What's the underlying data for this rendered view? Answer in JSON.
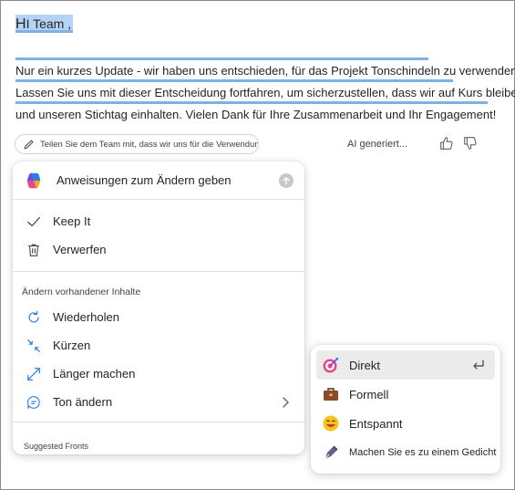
{
  "document": {
    "greeting_cap": "H",
    "greeting_rest": "I Team ,",
    "paragraph_lines": [
      "Nur ein kurzes Update - wir haben uns entschieden, für das Projekt Tonschindeln zu verwenden.",
      "Lassen Sie uns mit dieser Entscheidung fortfahren, um sicherzustellen, dass wir auf Kurs bleiben",
      "und unseren Stichtag einhalten. Vielen Dank für Ihre Zusammenarbeit und Ihr Engagement!"
    ]
  },
  "prompt_chip": {
    "text": "Teilen Sie dem Team mit, dass wir uns für die Verwendung entschieden haben..."
  },
  "ai_generated_label": "AI generiert...",
  "panel": {
    "instruction_placeholder": "Anweisungen zum Ändern geben",
    "actions": [
      {
        "label": "Keep It",
        "icon": "checkmark-icon"
      },
      {
        "label": "Verwerfen",
        "icon": "trash-icon"
      }
    ],
    "section_title": "Ändern vorhandener Inhalte",
    "modify_items": [
      {
        "label": "Wiederholen",
        "icon": "retry-icon"
      },
      {
        "label": "Kürzen",
        "icon": "shrink-icon"
      },
      {
        "label": "Länger machen",
        "icon": "expand-icon"
      },
      {
        "label": "Ton ändern",
        "icon": "chat-icon"
      }
    ],
    "bottom_peek": "Suggested Fronts"
  },
  "tone_menu": {
    "items": [
      {
        "label": "Direkt",
        "icon": "target-icon",
        "selected": true
      },
      {
        "label": "Formell",
        "icon": "briefcase-icon",
        "selected": false
      },
      {
        "label": "Entspannt",
        "icon": "smile-emoji-icon",
        "selected": false
      },
      {
        "label": "Machen Sie es zu einem Gedicht",
        "icon": "pen-nib-icon",
        "selected": false
      }
    ]
  },
  "colors": {
    "highlight": "#b4d3f5",
    "highlight_underline": "#7fb0e6",
    "selected_row": "#ebebeb"
  }
}
